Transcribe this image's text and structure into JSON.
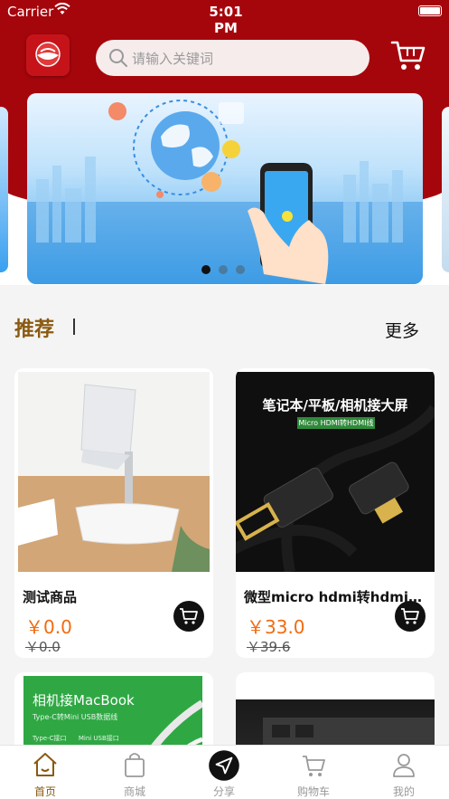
{
  "status_bar": {
    "carrier": "Carrier",
    "time": "5:01 PM"
  },
  "header": {
    "search_placeholder": "请输入关键词"
  },
  "banner": {
    "page_count": 3,
    "active_index": 0
  },
  "section": {
    "title": "推荐",
    "more_label": "更多"
  },
  "products": [
    {
      "name": "测试商品",
      "price": "￥0.0",
      "original_price": "￥0.0"
    },
    {
      "name": "微型micro hdmi转hdmi高清线",
      "price": "￥33.0",
      "original_price": "￥39.6",
      "image_headline": "笔记本/平板/相机接大屏",
      "image_tag": "Micro HDMI转HDMI线"
    },
    {
      "image_headline": "相机接MacBook",
      "image_sub": "Type-C转Mini USB数据线",
      "image_tags": "Type-C接口      Mini USB接口"
    },
    {}
  ],
  "tabbar": {
    "items": [
      {
        "label": "首页",
        "icon": "home-icon",
        "active": true
      },
      {
        "label": "商城",
        "icon": "shopping-bag-icon",
        "active": false
      },
      {
        "label": "分享",
        "icon": "share-icon",
        "active": false
      },
      {
        "label": "购物车",
        "icon": "cart-icon",
        "active": false
      },
      {
        "label": "我的",
        "icon": "user-icon",
        "active": false
      }
    ]
  },
  "colors": {
    "brand_red": "#a5060c",
    "accent_brown": "#8a5a10",
    "price_orange": "#f26b10"
  }
}
